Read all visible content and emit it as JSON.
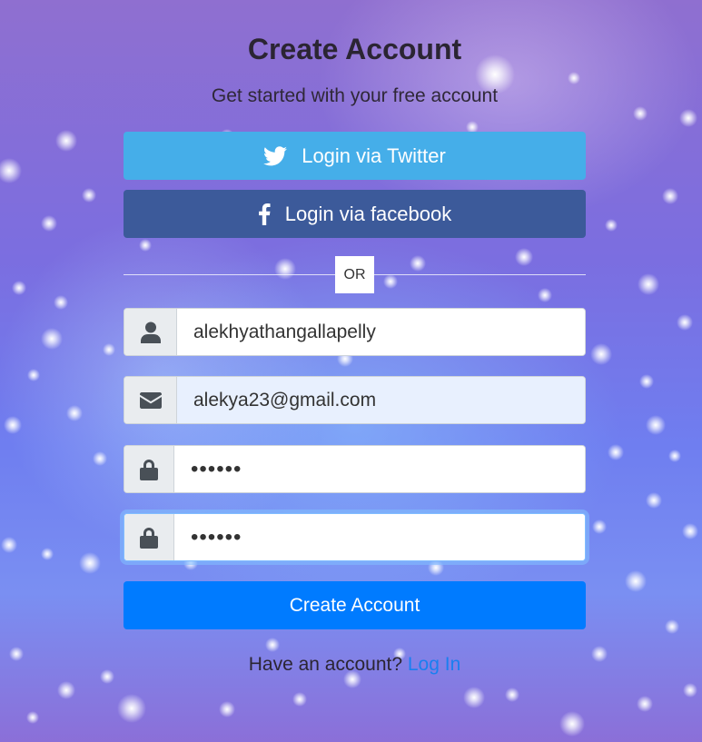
{
  "header": {
    "title": "Create Account",
    "subtitle": "Get started with your free account"
  },
  "social": {
    "twitter_label": "Login via Twitter",
    "facebook_label": "Login via facebook",
    "twitter_color": "#45aee9",
    "facebook_color": "#3c5a9a"
  },
  "divider": {
    "label": "OR"
  },
  "form": {
    "name_value": "alekhyathangallapelly",
    "email_value": "alekya23@gmail.com",
    "password_value": "••••••",
    "confirm_password_value": "••••••",
    "name_icon": "user-icon",
    "email_icon": "envelope-icon",
    "password_icon": "lock-icon",
    "submit_label": "Create Account",
    "submit_color": "#007bff"
  },
  "footer": {
    "prompt": "Have an account?",
    "login_link": "Log In"
  }
}
